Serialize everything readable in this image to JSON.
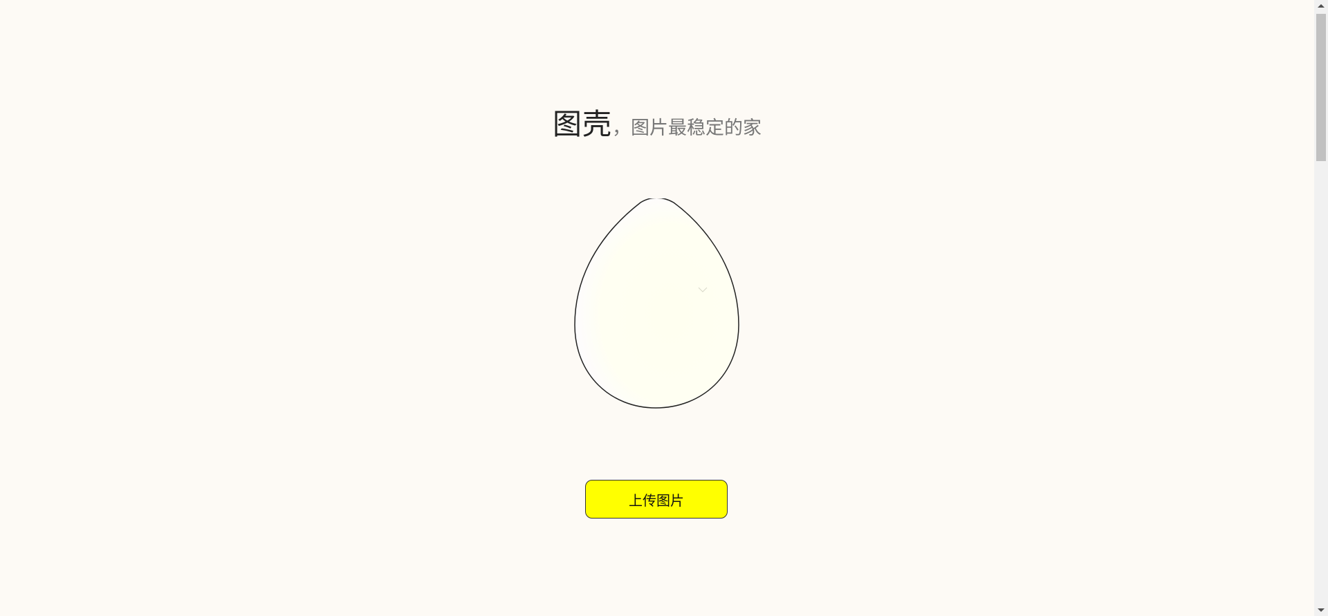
{
  "header": {
    "brand": "图壳",
    "tagline": "，图片最稳定的家"
  },
  "egg": {
    "icon": "egg-icon",
    "outline_color": "#222222",
    "fill_color": "#fffff0"
  },
  "upload": {
    "label": "上传图片",
    "color": "#ffff00"
  }
}
